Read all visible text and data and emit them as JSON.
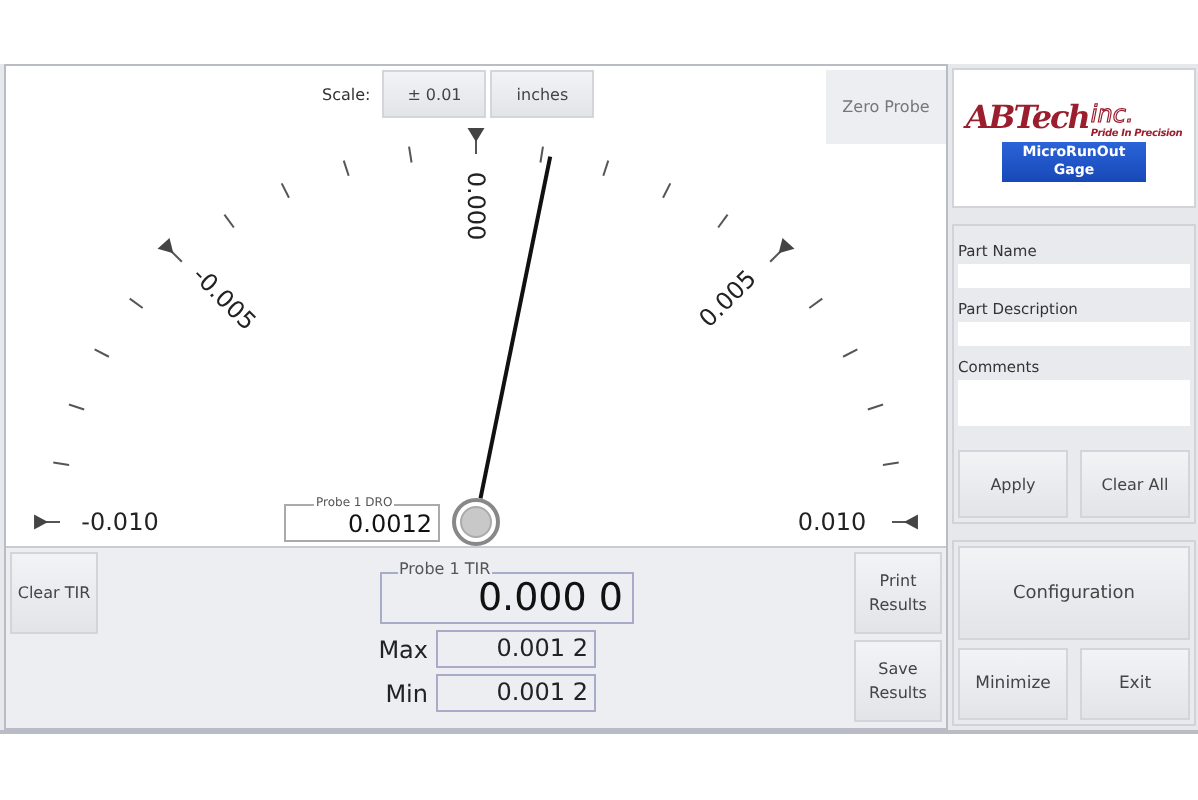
{
  "gauge": {
    "scale_label": "Scale:",
    "scale_buttons": [
      {
        "label": "± 0.01"
      },
      {
        "label": "inches"
      }
    ],
    "zero_button": "Zero Probe",
    "dial_labels": [
      "-0.010",
      "-0.005",
      "0.000",
      "0.005",
      "0.010"
    ],
    "level": 0.56,
    "dro": {
      "label": "Probe 1 DRO",
      "value": "0.0012"
    }
  },
  "results": {
    "clear_button": "Clear TIR",
    "tir": {
      "label": "Probe 1 TIR",
      "value": "0.000 0"
    },
    "readings": [
      {
        "label": "Max",
        "value": "0.001 2"
      },
      {
        "label": "Min",
        "value": "0.001 2"
      }
    ],
    "buttons": [
      "Print Results",
      "Save Results"
    ]
  },
  "logo": {
    "brand": "ABTech",
    "suffix": "inc.",
    "tagline": "Pride In Precision",
    "product": "MicroRunOut Gage"
  },
  "part_form": {
    "fields": [
      {
        "label": "Part Name",
        "tall": false
      },
      {
        "label": "Part Description",
        "tall": false
      },
      {
        "label": "Comments",
        "tall": true
      }
    ],
    "buttons": [
      "Apply",
      "Clear All"
    ]
  },
  "actions": {
    "configuration": "Configuration",
    "buttons": [
      "Minimize",
      "Exit"
    ]
  }
}
